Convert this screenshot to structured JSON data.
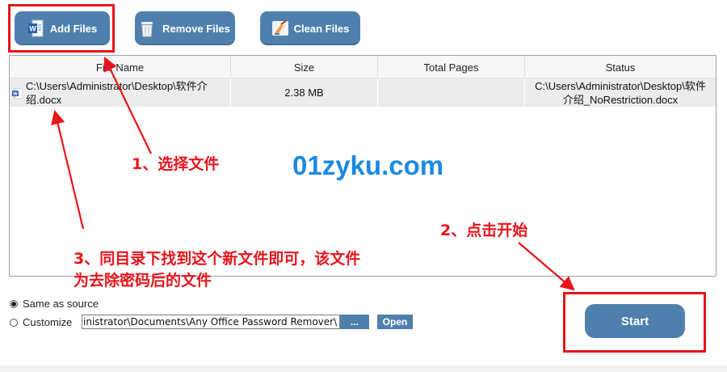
{
  "toolbar": {
    "add_files_label": "Add Files",
    "remove_files_label": "Remove Files",
    "clean_files_label": "Clean Files"
  },
  "table": {
    "columns": [
      "File Name",
      "Size",
      "Total Pages",
      "Status"
    ],
    "rows": [
      {
        "file_name_line1": "C:\\Users\\Administrator\\Desktop\\软件介",
        "file_name_line2": "绍.docx",
        "size": "2.38 MB",
        "total_pages": "",
        "status_line1": "C:\\Users\\Administrator\\Desktop\\软件",
        "status_line2": "介绍_NoRestriction.docx"
      }
    ]
  },
  "annotations": {
    "step1": "1、选择文件",
    "step2": "2、点击开始",
    "step3_line1": "3、同目录下找到这个新文件即可，该文件",
    "step3_line2": "为去除密码后的文件",
    "watermark": "01zyku.com"
  },
  "output": {
    "same_as_source_label": "Same as source",
    "customize_label": "Customize",
    "custom_path_value": "inistrator\\Documents\\Any Office Password Remover\\",
    "browse_label": "...",
    "open_label": "Open",
    "selected_option": "Same as source"
  },
  "start_label": "Start",
  "colors": {
    "button_blue": "#4f80ad",
    "annotation_red": "#e8141b",
    "watermark_blue": "#1a8ae0"
  },
  "icons": {
    "add_files": "word-document-icon",
    "remove_files": "trash-icon",
    "clean_files": "broom-clean-icon",
    "file_row": "word-document-icon"
  }
}
